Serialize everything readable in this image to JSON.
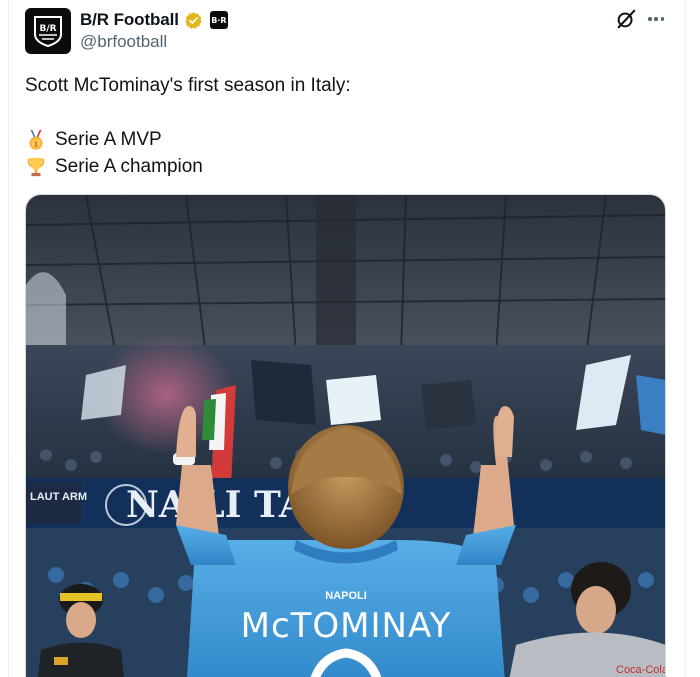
{
  "account": {
    "display_name": "B/R Football",
    "handle": "@brfootball",
    "avatar_text": "B/R",
    "affiliate_badge_text": "B·R",
    "verified_color": "#e2b719"
  },
  "tweet": {
    "intro": "Scott McTominay's first season in Italy:",
    "lines": [
      {
        "emoji": "medal-icon",
        "text": "Serie A MVP"
      },
      {
        "emoji": "trophy-icon",
        "text": "Serie A champion"
      }
    ]
  },
  "media": {
    "jersey_sponsor": "NAPOLI",
    "jersey_name": "McTOMINAY",
    "banner_text": "NA   LI   TAL",
    "side_banner": "LAUT ARM"
  },
  "colors": {
    "napoli_blue": "#3f9ad8",
    "text_primary": "#0f1419",
    "text_secondary": "#536471"
  },
  "icons": [
    "grok-icon",
    "more-icon",
    "verified-icon"
  ]
}
